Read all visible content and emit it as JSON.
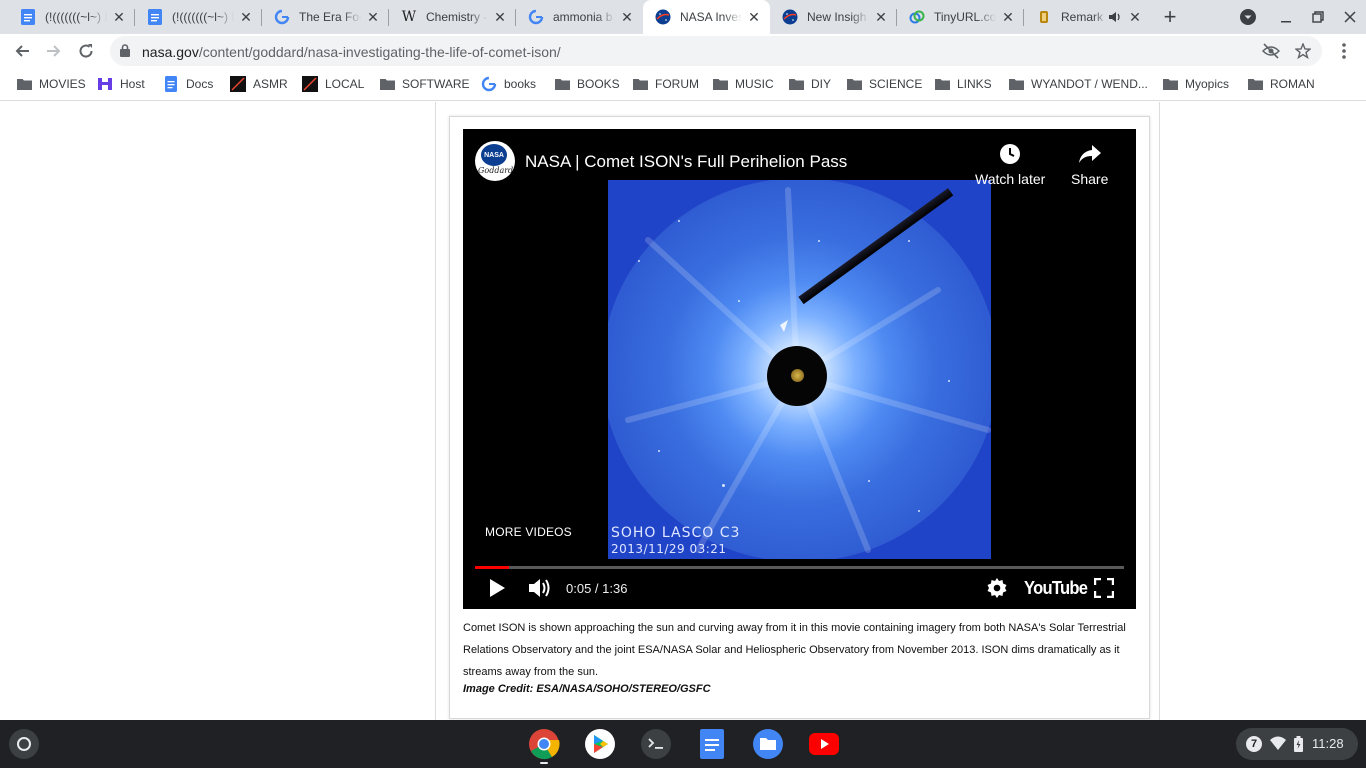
{
  "browser": {
    "tabs": [
      {
        "title": "(!(((((((~l~) E",
        "favicon": "google-docs-icon"
      },
      {
        "title": "(!(((((((~l~) E",
        "favicon": "google-docs-icon"
      },
      {
        "title": "The Era For",
        "favicon": "google-g-icon"
      },
      {
        "title": "Chemistry -",
        "favicon": "wikipedia-icon"
      },
      {
        "title": "ammonia b",
        "favicon": "google-g-icon"
      },
      {
        "title": "NASA Inves",
        "favicon": "nasa-icon",
        "active": true
      },
      {
        "title": "New Insigh",
        "favicon": "nasa-icon"
      },
      {
        "title": "TinyURL.co",
        "favicon": "tinyurl-icon"
      },
      {
        "title": "Remark",
        "favicon": "remark-icon",
        "audio": true
      }
    ],
    "url_host": "nasa.gov",
    "url_path": "/content/goddard/nasa-investigating-the-life-of-comet-ison/",
    "bookmarks": [
      {
        "label": "MOVIES",
        "icon": "folder-icon"
      },
      {
        "label": "Host",
        "icon": "host-icon"
      },
      {
        "label": "Docs",
        "icon": "google-docs-icon"
      },
      {
        "label": "ASMR",
        "icon": "asmr-icon"
      },
      {
        "label": "LOCAL",
        "icon": "local-icon"
      },
      {
        "label": "SOFTWARE",
        "icon": "folder-icon"
      },
      {
        "label": "books",
        "icon": "google-g-icon"
      },
      {
        "label": "BOOKS",
        "icon": "folder-icon"
      },
      {
        "label": "FORUM",
        "icon": "folder-icon"
      },
      {
        "label": "MUSIC",
        "icon": "folder-icon"
      },
      {
        "label": "DIY",
        "icon": "folder-icon"
      },
      {
        "label": "SCIENCE",
        "icon": "folder-icon"
      },
      {
        "label": "LINKS",
        "icon": "folder-icon"
      },
      {
        "label": "WYANDOT / WEND...",
        "icon": "folder-icon"
      },
      {
        "label": "Myopics",
        "icon": "folder-icon"
      },
      {
        "label": "ROMAN",
        "icon": "folder-icon"
      }
    ]
  },
  "video": {
    "title": "NASA | Comet ISON's Full Perihelion Pass",
    "channel_logo_text": "NASA",
    "channel_logo_script": "Goddard",
    "watch_later": "Watch later",
    "share": "Share",
    "more_videos": "MORE VIDEOS",
    "overlay_instrument": "SOHO LASCO C3",
    "overlay_date": "2013/11/29 03:21",
    "current_time": "0:05",
    "duration": "1:36",
    "time_readout": "0:05 / 1:36",
    "progress_fraction": 0.052,
    "youtube_wordmark": "YouTube"
  },
  "article": {
    "caption": "Comet ISON is shown approaching the sun and curving away from it in this movie containing imagery from both NASA's Solar Terrestrial Relations Observatory and the joint ESA/NASA Solar and Heliospheric Observatory from November 2013. ISON dims dramatically as it streams away from the sun.",
    "credit": "Image Credit: ESA/NASA/SOHO/STEREO/GSFC"
  },
  "shelf": {
    "apps": [
      "chrome-icon",
      "play-store-icon",
      "terminal-icon",
      "google-docs-icon",
      "files-icon",
      "youtube-icon"
    ],
    "notification_count": "7",
    "time": "11:28"
  },
  "colors": {
    "tabstrip": "#dee1e6",
    "youtube_red": "#ff0000",
    "shelf": "#202124",
    "nasa_blue": "#0b3d91",
    "lasco_blue": "#2044c8"
  }
}
